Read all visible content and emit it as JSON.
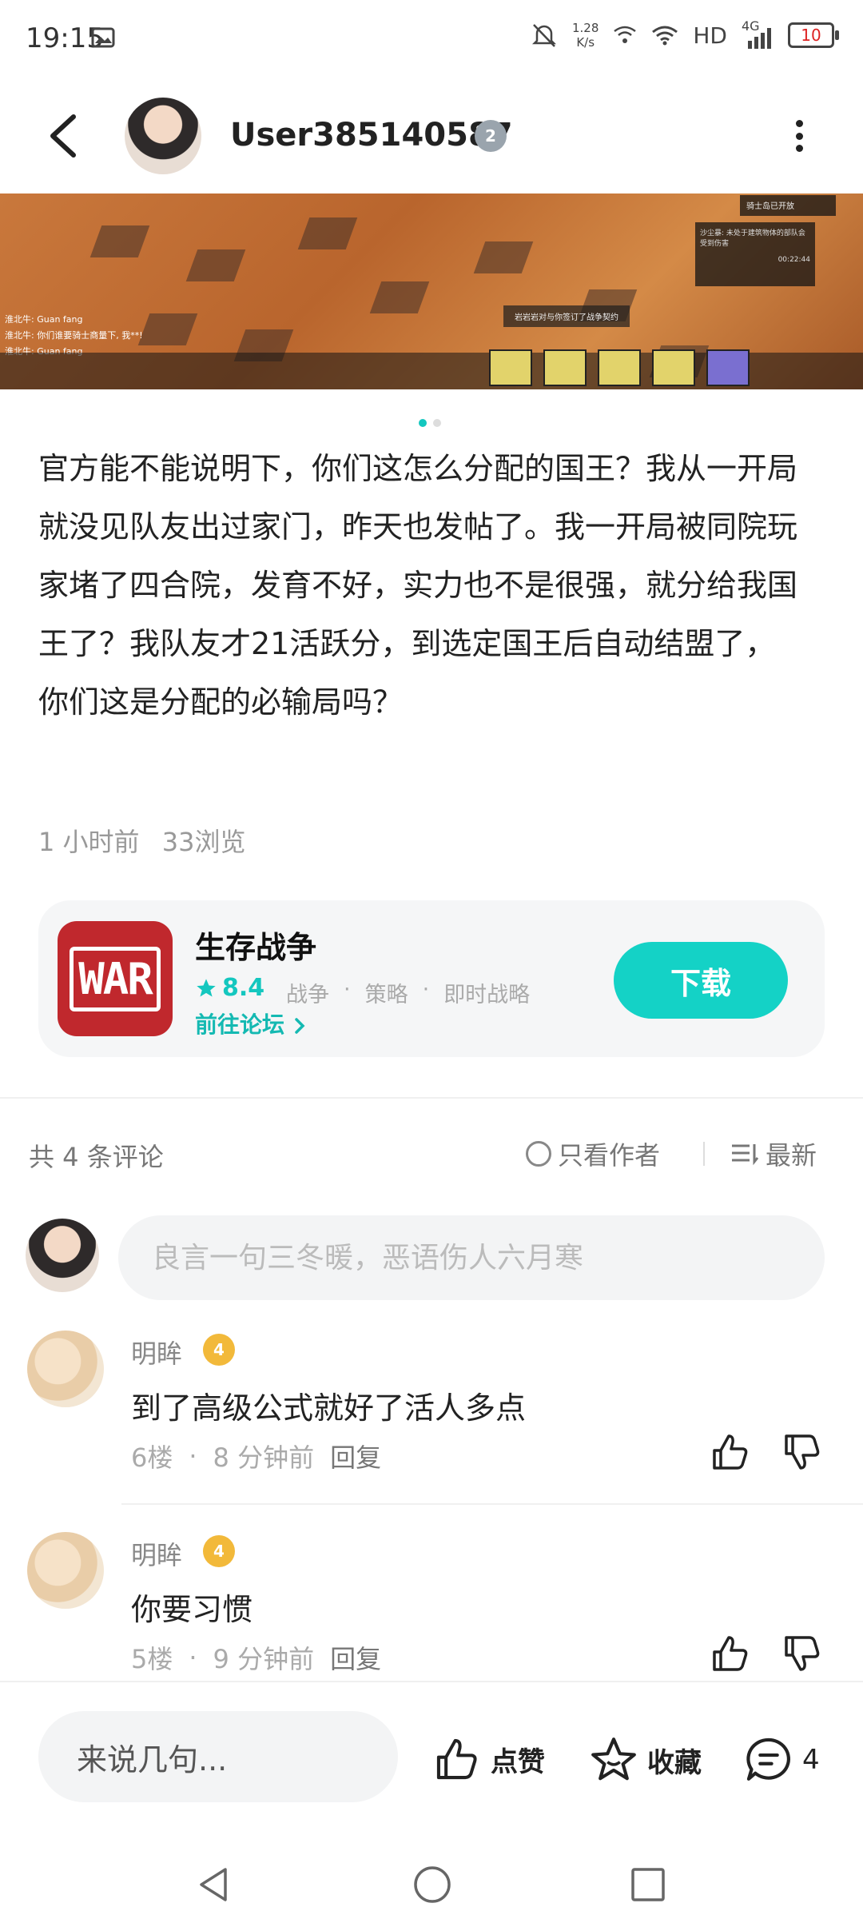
{
  "status_bar": {
    "time": "19:15",
    "speed_value": "1.28",
    "speed_unit": "K/s",
    "network": "HD",
    "signal": "4G",
    "battery": "10"
  },
  "header": {
    "username": "User385140587",
    "level_badge": "2"
  },
  "banner": {
    "chat_lines": [
      "淮北牛: Guan fang",
      "淮北牛: 你们谁要骑士商量下, 我**!",
      "淮北牛: Guan fang"
    ],
    "toast": "岩岩岩对与你签订了战争契约",
    "panel_title": "骑士岛已开放",
    "panel_text": "沙尘暴: 未处于建筑物体的部队会受到伤害",
    "panel_timer": "00:22:44",
    "page_dots": 2,
    "active_dot": 0
  },
  "post": {
    "text": "官方能不能说明下，你们这怎么分配的国王？我从一开局就没见队友出过家门，昨天也发帖了。我一开局被同院玩家堵了四合院，发育不好，实力也不是很强，就分给我国王了？我队友才21活跃分，到选定国王后自动结盟了，你们这是分配的必输局吗？",
    "time_ago": "1 小时前",
    "views": "33浏览"
  },
  "app_card": {
    "name": "生存战争",
    "icon_text": "WAR",
    "rating": "8.4",
    "tags": [
      "战争",
      "·",
      "策略",
      "·",
      "即时战略"
    ],
    "forum_link": "前往论坛",
    "download_label": "下载"
  },
  "comments_header": {
    "count": "共 4 条评论",
    "author_only": "只看作者",
    "sort": "最新"
  },
  "comment_input": {
    "placeholder": "良言一句三冬暖，恶语伤人六月寒"
  },
  "comments": [
    {
      "name": "明眸",
      "badge": "4",
      "text": "到了高级公式就好了活人多点",
      "floor": "6楼",
      "dot": "·",
      "time": "8 分钟前",
      "reply": "回复"
    },
    {
      "name": "明眸",
      "badge": "4",
      "text": "你要习惯",
      "floor": "5楼",
      "dot": "·",
      "time": "9 分钟前",
      "reply": "回复"
    }
  ],
  "bottom_bar": {
    "say_placeholder": "来说几句...",
    "like": "点赞",
    "favorite": "收藏",
    "comment_count": "4"
  },
  "colors": {
    "accent": "#14d2c6",
    "badge_gold": "#f2b93a",
    "badge_gray": "#9aa4ad"
  }
}
